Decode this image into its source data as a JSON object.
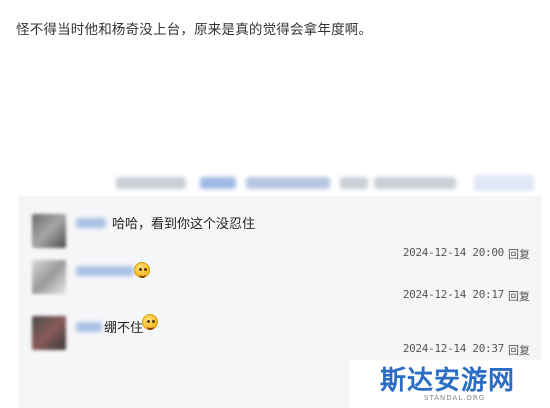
{
  "post": {
    "text": "怪不得当时他和杨奇没上台，原来是真的觉得会拿年度啊。"
  },
  "replies": [
    {
      "content": "哈哈，看到你这个没忍住",
      "timestamp": "2024-12-14 20:00",
      "reply_label": "回复",
      "has_emoji": false
    },
    {
      "content": "",
      "timestamp": "2024-12-14 20:17",
      "reply_label": "回复",
      "has_emoji": true,
      "emoji": "smiling-face-icon"
    },
    {
      "content": "绷不住",
      "timestamp": "2024-12-14 20:37",
      "reply_label": "回复",
      "has_emoji": true,
      "emoji": "laughing-face-icon"
    }
  ],
  "watermark": {
    "title": "斯达安游网",
    "subtitle": "STANDAL.ORG"
  },
  "colors": {
    "thread_bg": "#f5f6f8",
    "username_blue": "#a9c0e6",
    "watermark_blue": "#2b6cc4"
  }
}
